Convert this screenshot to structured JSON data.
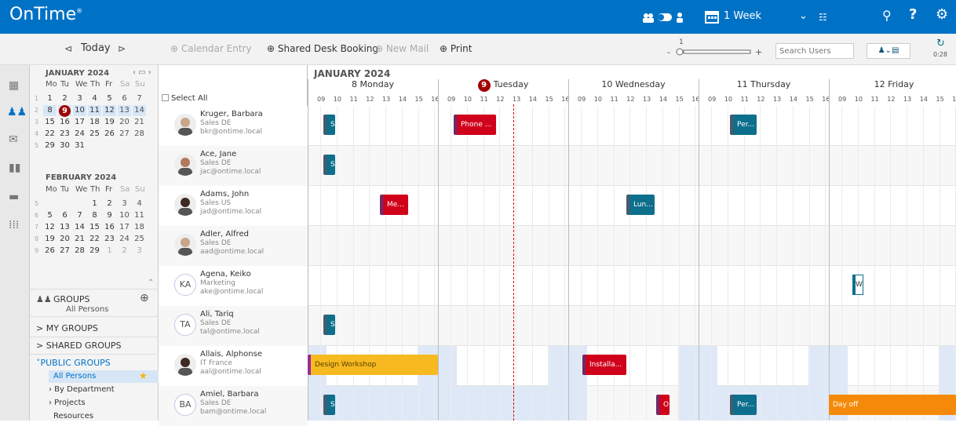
{
  "app": {
    "title": "OnTime",
    "reg": "®"
  },
  "topbar": {
    "view_label": "1 Week"
  },
  "toolbar": {
    "today": "Today",
    "calendar_entry": "Calendar Entry",
    "shared_desk": "Shared Desk Booking",
    "new_mail": "New Mail",
    "print": "Print",
    "zoom_value": "1",
    "zoom_minus": "-",
    "zoom_plus": "+",
    "search_placeholder": "Search Users",
    "refresh_time": "0:28"
  },
  "minical": {
    "jan_title": "JANUARY 2024",
    "feb_title": "FEBRUARY 2024",
    "weekday_labels": [
      "Mo",
      "Tu",
      "We",
      "Th",
      "Fr",
      "Sa",
      "Su"
    ],
    "jan_weeks": [
      {
        "wk": "1",
        "days": [
          "1",
          "2",
          "3",
          "4",
          "5",
          "6",
          "7"
        ]
      },
      {
        "wk": "2",
        "days": [
          "8",
          "9",
          "10",
          "11",
          "12",
          "13",
          "14"
        ]
      },
      {
        "wk": "3",
        "days": [
          "15",
          "16",
          "17",
          "18",
          "19",
          "20",
          "21"
        ]
      },
      {
        "wk": "4",
        "days": [
          "22",
          "23",
          "24",
          "25",
          "26",
          "27",
          "28"
        ]
      },
      {
        "wk": "5",
        "days": [
          "29",
          "30",
          "31",
          "",
          "",
          "",
          ""
        ]
      }
    ],
    "feb_weeks": [
      {
        "wk": "5",
        "days": [
          "",
          "",
          "",
          "1",
          "2",
          "3",
          "4"
        ]
      },
      {
        "wk": "6",
        "days": [
          "5",
          "6",
          "7",
          "8",
          "9",
          "10",
          "11"
        ]
      },
      {
        "wk": "7",
        "days": [
          "12",
          "13",
          "14",
          "15",
          "16",
          "17",
          "18"
        ]
      },
      {
        "wk": "8",
        "days": [
          "19",
          "20",
          "21",
          "22",
          "23",
          "24",
          "25"
        ]
      },
      {
        "wk": "9",
        "days": [
          "26",
          "27",
          "28",
          "29",
          "1",
          "2",
          "3"
        ]
      }
    ]
  },
  "groups": {
    "title": "GROUPS",
    "subtitle": "All Persons",
    "my_groups": "> MY GROUPS",
    "shared_groups": "> SHARED GROUPS",
    "public_groups": "˅PUBLIC GROUPS",
    "items": [
      "All Persons",
      "› By Department",
      "› Projects",
      "Resources"
    ]
  },
  "people_header": {
    "select_all": "Select All"
  },
  "people": [
    {
      "name": "Kruger, Barbara",
      "dept": "Sales DE",
      "email": "bkr@ontime.local",
      "initials": ""
    },
    {
      "name": "Ace, Jane",
      "dept": "Sales DE",
      "email": "jac@ontime.local",
      "initials": ""
    },
    {
      "name": "Adams, John",
      "dept": "Sales US",
      "email": "jad@ontime.local",
      "initials": ""
    },
    {
      "name": "Adler, Alfred",
      "dept": "Sales DE",
      "email": "aad@ontime.local",
      "initials": ""
    },
    {
      "name": "Agena, Keiko",
      "dept": "Marketing",
      "email": "ake@ontime.local",
      "initials": "KA"
    },
    {
      "name": "Ali, Tariq",
      "dept": "Sales DE",
      "email": "tal@ontime.local",
      "initials": "TA"
    },
    {
      "name": "Allais, Alphonse",
      "dept": "IT France",
      "email": "aal@ontime.local",
      "initials": ""
    },
    {
      "name": "Amiel, Barbara",
      "dept": "Sales DE",
      "email": "bam@ontime.local",
      "initials": "BA"
    }
  ],
  "grid": {
    "month": "JANUARY 2024",
    "days": [
      {
        "num": "8",
        "name": "Monday"
      },
      {
        "num": "9",
        "name": "Tuesday"
      },
      {
        "num": "10",
        "name": "Wednesday"
      },
      {
        "num": "11",
        "name": "Thursday"
      },
      {
        "num": "12",
        "name": "Friday"
      }
    ],
    "hours": [
      "09",
      "10",
      "11",
      "12",
      "13",
      "14",
      "15",
      "16"
    ]
  },
  "events": {
    "kruger_1": "S.",
    "kruger_2": "Phone ...",
    "kruger_3": "Per...",
    "ace_1": "S.",
    "adams_1": "Me...",
    "adams_2": "Lun...",
    "agena_1": "W",
    "ali_1": "S.",
    "allais_1": "Design Workshop",
    "allais_2": "Installa...",
    "amiel_1": "S.",
    "amiel_2": "O",
    "amiel_3": "Per...",
    "amiel_4": "Day off"
  },
  "colors": {
    "brand": "#0072c6",
    "event_blue": "#0d6f8c",
    "event_red": "#d0021b",
    "event_yellow": "#f6b91f",
    "event_orange": "#f58a0a",
    "today": "#a00000"
  }
}
